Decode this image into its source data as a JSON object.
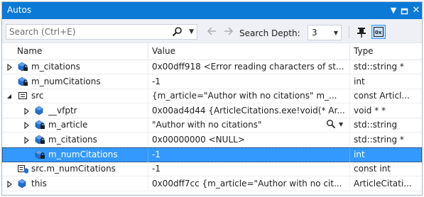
{
  "window": {
    "title": "Autos",
    "dropdown_icon": "chevron-down-icon",
    "restore_icon": "restore-window-icon",
    "close_icon": "close-icon"
  },
  "toolbar": {
    "search_placeholder": "Search (Ctrl+E)",
    "search_depth_label": "Search Depth:",
    "search_depth_value": "3",
    "back_icon": "arrow-left-icon",
    "forward_icon": "arrow-right-icon",
    "pin_icon": "pin-icon",
    "hex_icon": "hexadecimal-display-icon"
  },
  "columns": {
    "name": "Name",
    "value": "Value",
    "type": "Type"
  },
  "rows": [
    {
      "name": "m_citations",
      "value": "0x00dff918 <Error reading characters of st...",
      "type": "std::string *",
      "indent": 0,
      "expand": "collapsed",
      "icon": "private-field-icon"
    },
    {
      "name": "m_numCitations",
      "value": "-1",
      "type": "int",
      "indent": 0,
      "expand": "none",
      "icon": "private-field-icon"
    },
    {
      "name": "src",
      "value": "{m_article=\"Author with no citations\" m_...",
      "type": "const Articl...",
      "indent": 0,
      "expand": "expanded",
      "icon": "local-variable-icon"
    },
    {
      "name": "__vfptr",
      "value": "0x00ad4d44 {ArticleCitations.exe!void(* Ar...",
      "type": "void * *",
      "indent": 1,
      "expand": "collapsed",
      "icon": "field-icon"
    },
    {
      "name": "m_article",
      "value": "\"Author with no citations\"",
      "type": "std::string",
      "indent": 1,
      "expand": "collapsed",
      "icon": "private-field-icon"
    },
    {
      "name": "m_citations",
      "value": "0x00000000 <NULL>",
      "type": "std::string *",
      "indent": 1,
      "expand": "collapsed",
      "icon": "private-field-icon"
    },
    {
      "name": "m_numCitations",
      "value": "-1",
      "type": "int",
      "indent": 1,
      "expand": "none",
      "icon": "private-field-icon",
      "selected": true
    },
    {
      "name": "src.m_numCitations",
      "value": "-1",
      "type": "const int",
      "indent": 0,
      "expand": "none",
      "icon": "expression-icon"
    },
    {
      "name": "this",
      "value": "0x00dff7cc {m_article=\"Author with no cit...",
      "type": "ArticleCitati...",
      "indent": 0,
      "expand": "collapsed",
      "icon": "field-icon"
    }
  ],
  "visualizer": {
    "icon": "magnifier-visualizer-icon",
    "dropdown_icon": "chevron-down-icon"
  },
  "colors": {
    "titlebar": "#0b7ad7",
    "selection": "#3399ff",
    "toolbar": "#eef0f5"
  }
}
